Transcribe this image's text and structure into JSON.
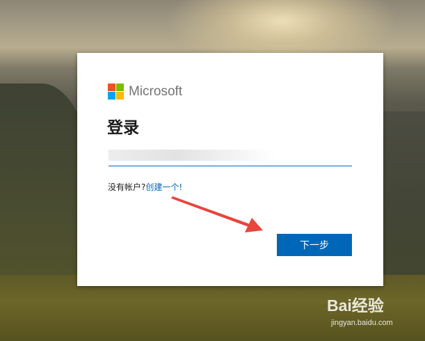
{
  "background": {
    "theme": "sunset-landscape"
  },
  "logo": {
    "text": "Microsoft",
    "colors": [
      "#f25022",
      "#7fba00",
      "#00a4ef",
      "#ffb900"
    ]
  },
  "signin": {
    "title": "登录",
    "email_value": "",
    "no_account_text": "没有帐户?",
    "create_link_text": "创建一个!",
    "next_button_label": "下一步"
  },
  "annotation": {
    "type": "red-arrow",
    "points_to": "next-button",
    "color": "#e8453c"
  },
  "watermark": {
    "brand": "Bai经验",
    "url": "jingyan.baidu.com"
  },
  "colors": {
    "accent": "#0067b8",
    "text": "#1b1b1b",
    "logo_text": "#737373"
  }
}
